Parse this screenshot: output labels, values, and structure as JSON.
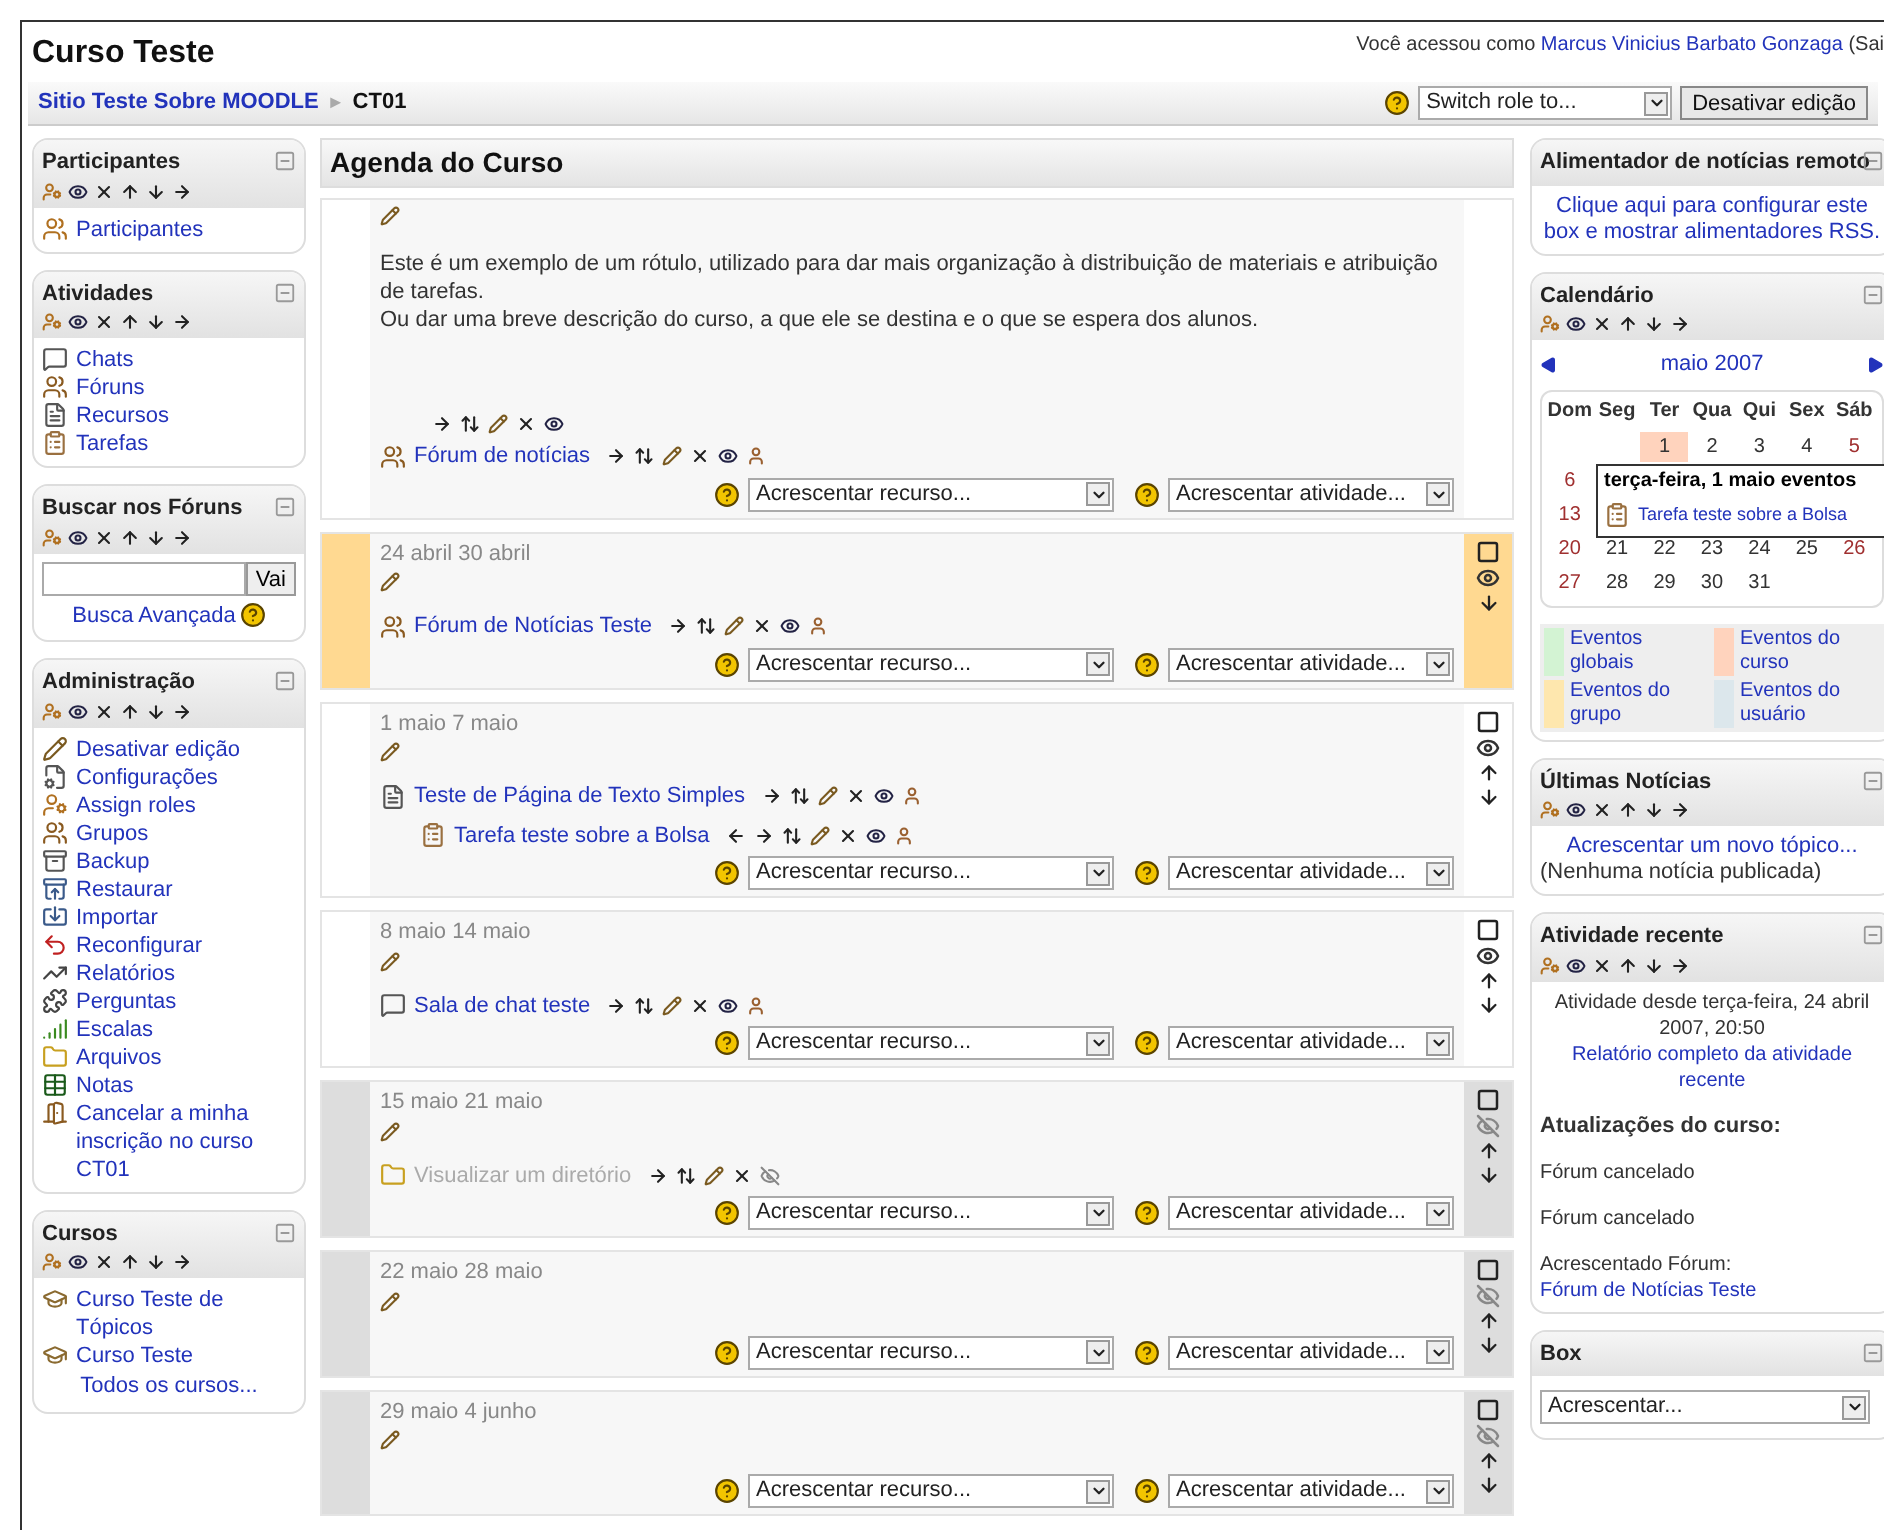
{
  "header": {
    "course_title": "Curso Teste",
    "login_prefix": "Você acessou como",
    "user_name": "Marcus Vinicius Barbato Gonzaga",
    "logout_fragment": "(Sai"
  },
  "breadcrumb": {
    "site": "Sitio Teste Sobre MOODLE",
    "separator": "►",
    "current": "CT01"
  },
  "role_switch": {
    "value": "Switch role to..."
  },
  "edit_button": "Desativar edição",
  "left_blocks": [
    {
      "kind": "list",
      "title": "Participantes",
      "controls": true,
      "items": [
        {
          "kind": "people",
          "label": "Participantes"
        }
      ]
    },
    {
      "kind": "list",
      "title": "Atividades",
      "controls": true,
      "items": [
        {
          "kind": "chat",
          "label": "Chats"
        },
        {
          "kind": "forum",
          "label": "Fóruns"
        },
        {
          "kind": "resource",
          "label": "Recursos"
        },
        {
          "kind": "assignment",
          "label": "Tarefas"
        }
      ]
    },
    {
      "kind": "search",
      "title": "Buscar nos Fóruns",
      "controls": true,
      "button": "Vai",
      "link": "Busca Avançada"
    },
    {
      "kind": "list",
      "title": "Administração",
      "controls": true,
      "items": [
        {
          "kind": "edit",
          "label": "Desativar edição"
        },
        {
          "kind": "settings",
          "label": "Configurações"
        },
        {
          "kind": "roles",
          "label": "Assign roles"
        },
        {
          "kind": "groups",
          "label": "Grupos"
        },
        {
          "kind": "backup",
          "label": "Backup"
        },
        {
          "kind": "restore",
          "label": "Restaurar"
        },
        {
          "kind": "import",
          "label": "Importar"
        },
        {
          "kind": "reset",
          "label": "Reconfigurar"
        },
        {
          "kind": "reports",
          "label": "Relatórios"
        },
        {
          "kind": "questions",
          "label": "Perguntas"
        },
        {
          "kind": "scales",
          "label": "Escalas"
        },
        {
          "kind": "files",
          "label": "Arquivos"
        },
        {
          "kind": "grades",
          "label": "Notas"
        },
        {
          "kind": "unenrol",
          "label": "Cancelar a minha inscrição no curso CT01"
        }
      ]
    },
    {
      "kind": "list",
      "title": "Cursos",
      "controls": true,
      "items": [
        {
          "kind": "course",
          "label": "Curso Teste de Tópicos"
        },
        {
          "kind": "course",
          "label": "Curso Teste"
        }
      ],
      "footer": "Todos os cursos..."
    }
  ],
  "main": {
    "title": "Agenda do Curso",
    "sections": [
      {
        "kind": "general",
        "current": false,
        "visible": true,
        "summary": [
          "Este é um exemplo de um rótulo, utilizado para dar mais organização à distribuição de materiais e atribuição de tarefas.",
          "Ou dar uma breve descrição do curso, a que ele se destina e o que se espera dos alunos."
        ],
        "items": [
          {
            "kind": "label",
            "indented": false,
            "visible": true
          },
          {
            "kind": "forum",
            "label": "Fórum de notícias",
            "indented": false,
            "visible": true
          }
        ],
        "add_resource": "Acrescentar recurso...",
        "add_activity": "Acrescentar atividade..."
      },
      {
        "kind": "week",
        "dates": "24 abril 30 abril",
        "current": true,
        "visible": true,
        "items": [
          {
            "kind": "forum",
            "label": "Fórum de Notícias Teste",
            "indented": false,
            "visible": true
          }
        ],
        "add_resource": "Acrescentar recurso...",
        "add_activity": "Acrescentar atividade..."
      },
      {
        "kind": "week",
        "dates": "1 maio 7 maio",
        "current": false,
        "visible": true,
        "items": [
          {
            "kind": "page",
            "label": "Teste de Página de Texto Simples",
            "indented": false,
            "visible": true
          },
          {
            "kind": "assignment",
            "label": "Tarefa teste sobre a Bolsa",
            "indented": true,
            "visible": true
          }
        ],
        "add_resource": "Acrescentar recurso...",
        "add_activity": "Acrescentar atividade..."
      },
      {
        "kind": "week",
        "dates": "8 maio 14 maio",
        "current": false,
        "visible": true,
        "items": [
          {
            "kind": "chat",
            "label": "Sala de chat teste",
            "indented": false,
            "visible": true
          }
        ],
        "add_resource": "Acrescentar recurso...",
        "add_activity": "Acrescentar atividade..."
      },
      {
        "kind": "week",
        "dates": "15 maio 21 maio",
        "current": false,
        "visible": false,
        "items": [
          {
            "kind": "folder",
            "label": "Visualizar um diretório",
            "indented": false,
            "visible": false
          }
        ],
        "add_resource": "Acrescentar recurso...",
        "add_activity": "Acrescentar atividade..."
      },
      {
        "kind": "week",
        "dates": "22 maio 28 maio",
        "current": false,
        "visible": false,
        "add_resource": "Acrescentar recurso...",
        "add_activity": "Acrescentar atividade..."
      },
      {
        "kind": "week",
        "dates": "29 maio 4 junho",
        "current": false,
        "visible": false,
        "add_resource": "Acrescentar recurso...",
        "add_activity": "Acrescentar atividade..."
      }
    ]
  },
  "right_blocks": [
    {
      "kind": "rss",
      "title": "Alimentador de notícias remoto",
      "controls": false,
      "link": "Clique aqui para configurar este box e mostrar alimentadores RSS."
    },
    {
      "kind": "calendar",
      "title": "Calendário",
      "controls": true,
      "month": "maio 2007",
      "weekdays": [
        "Dom",
        "Seg",
        "Ter",
        "Qua",
        "Qui",
        "Sex",
        "Sáb"
      ],
      "weeks": [
        {
          "days": [
            {
              "day": "1",
              "today": true
            },
            {
              "day": "2",
              "today": false
            },
            {
              "day": "3",
              "today": false
            },
            {
              "day": "4",
              "today": false
            },
            {
              "day": "5",
              "today": false
            }
          ]
        },
        {
          "days": [
            {
              "day": "6",
              "today": false
            }
          ]
        },
        {
          "days": [
            {
              "day": "13",
              "today": false
            }
          ]
        },
        {
          "days": [
            {
              "day": "20",
              "today": false
            },
            {
              "day": "21",
              "today": false
            },
            {
              "day": "22",
              "today": false
            },
            {
              "day": "23",
              "today": false
            },
            {
              "day": "24",
              "today": false
            },
            {
              "day": "25",
              "today": false
            },
            {
              "day": "26",
              "today": false
            }
          ]
        },
        {
          "days": [
            {
              "day": "27",
              "today": false
            },
            {
              "day": "28",
              "today": false
            },
            {
              "day": "29",
              "today": false
            },
            {
              "day": "30",
              "today": false
            },
            {
              "day": "31",
              "today": false
            }
          ]
        }
      ],
      "tooltip": {
        "title": "terça-feira, 1 maio eventos",
        "event": "Tarefa teste sobre a Bolsa"
      },
      "legend": [
        {
          "label": "Eventos globais",
          "color": "#d3f3d3"
        },
        {
          "label": "Eventos do curso",
          "color": "#ffd3bd"
        },
        {
          "label": "Eventos do grupo",
          "color": "#fee7ae"
        },
        {
          "label": "Eventos do usuário",
          "color": "#dce7ec"
        }
      ]
    },
    {
      "kind": "news",
      "title": "Últimas Notícias",
      "controls": true,
      "link": "Acrescentar um novo tópico...",
      "note": "(Nenhuma notícia publicada)"
    },
    {
      "kind": "recent",
      "title": "Atividade recente",
      "controls": true,
      "since": "Atividade desde terça-feira, 24 abril 2007, 20:50",
      "link": "Relatório completo da atividade recente",
      "heading": "Atualizações do curso:",
      "entries": [
        {
          "text": "Fórum cancelado"
        },
        {
          "text": "Fórum cancelado"
        },
        {
          "text": "Acrescentado Fórum:",
          "link": "Fórum de Notícias Teste"
        }
      ]
    },
    {
      "kind": "add",
      "title": "Box",
      "controls": false,
      "select": "Acrescentar..."
    }
  ]
}
